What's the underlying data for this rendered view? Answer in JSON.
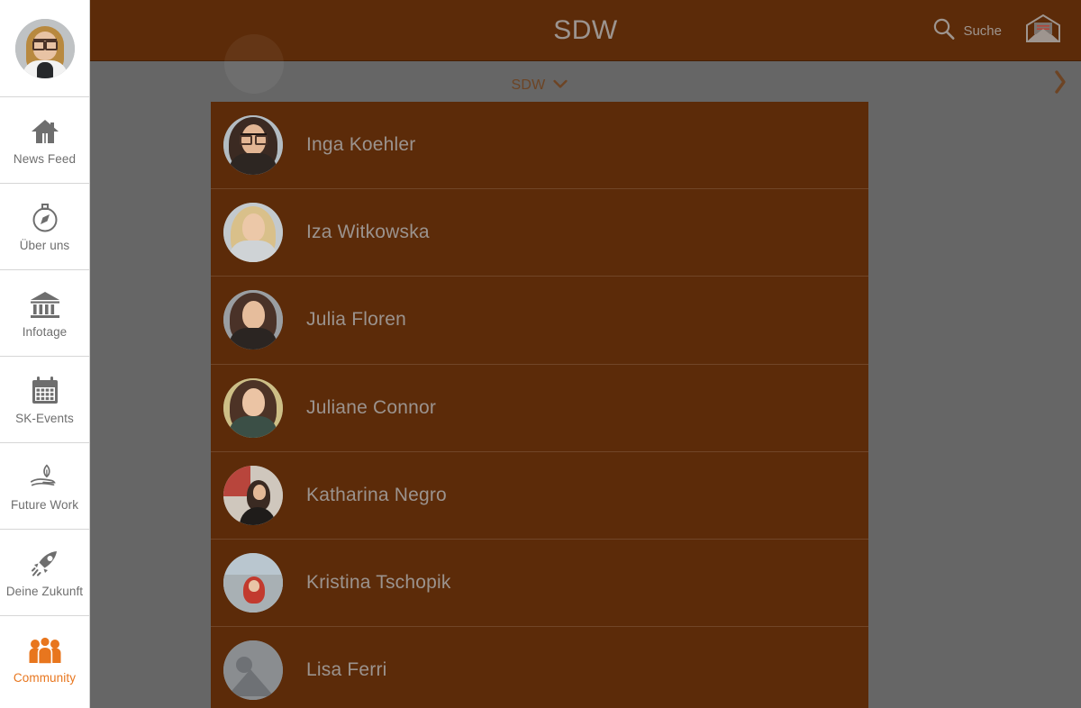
{
  "sidebar": {
    "avatar_name": "user-profile-photo",
    "items": [
      {
        "label": "News Feed",
        "icon": "home-icon",
        "active": false
      },
      {
        "label": "Über uns",
        "icon": "compass-icon",
        "active": false
      },
      {
        "label": "Infotage",
        "icon": "bank-icon",
        "active": false
      },
      {
        "label": "SK-Events",
        "icon": "calendar-icon",
        "active": false
      },
      {
        "label": "Future Work",
        "icon": "hand-leaf-icon",
        "active": false
      },
      {
        "label": "Deine Zukunft",
        "icon": "rocket-icon",
        "active": false
      },
      {
        "label": "Community",
        "icon": "people-icon",
        "active": true
      }
    ]
  },
  "header": {
    "title": "SDW",
    "search_label": "Suche",
    "search_icon": "search-icon",
    "mail_icon": "envelope-icon",
    "bg_color": "#5C2B09",
    "title_color": "#9C948F"
  },
  "dropdown": {
    "label": "SDW",
    "chevron_icon": "chevron-down-icon",
    "text_color": "#6D4424"
  },
  "right_nav": {
    "icon": "chevron-right-icon"
  },
  "member_list": {
    "members": [
      {
        "name": "Inga Koehler",
        "avatar": "photo-inga-koehler"
      },
      {
        "name": "Iza Witkowska",
        "avatar": "photo-iza-witkowska"
      },
      {
        "name": "Julia Floren",
        "avatar": "photo-julia-floren"
      },
      {
        "name": "Juliane Connor",
        "avatar": "photo-juliane-connor"
      },
      {
        "name": "Katharina Negro",
        "avatar": "photo-katharina-negro"
      },
      {
        "name": "Kristina Tschopik",
        "avatar": "photo-kristina-tschopik"
      },
      {
        "name": "Lisa Ferri",
        "avatar": "placeholder-image-icon"
      }
    ],
    "row_bg_color": "#5C2B09",
    "name_color": "#9B938E"
  },
  "overlay": {
    "backdrop_color": "rgba(0,0,0,0.60)"
  },
  "accent_color": "#E8761E"
}
